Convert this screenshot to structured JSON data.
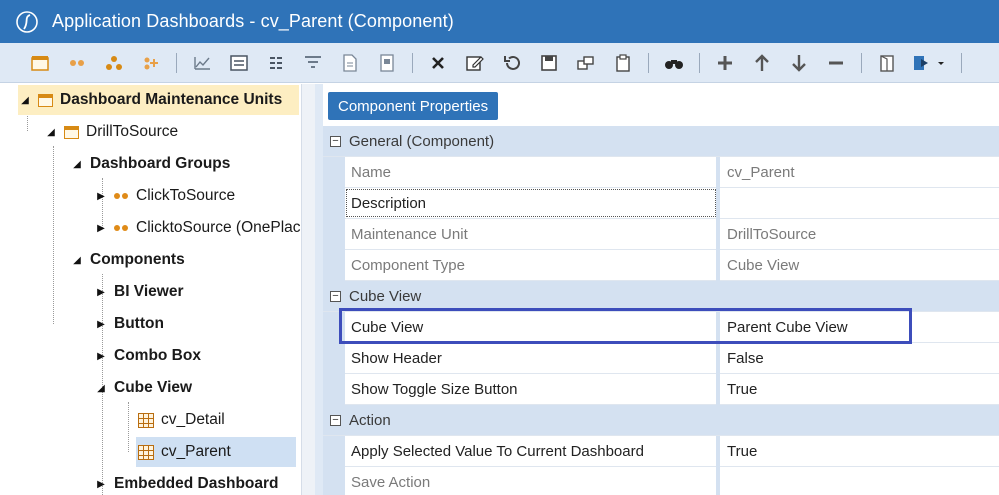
{
  "window": {
    "title": "Application Dashboards - cv_Parent (Component)"
  },
  "toolbar": {
    "buttons": [
      {
        "icon": "dashboard-icon"
      },
      {
        "icon": "dots-icon"
      },
      {
        "icon": "group-icon"
      },
      {
        "icon": "add-group-icon"
      },
      {
        "icon": "chart-icon"
      },
      {
        "icon": "form-icon"
      },
      {
        "icon": "list-icon"
      },
      {
        "icon": "filter-icon"
      },
      {
        "icon": "document-icon"
      },
      {
        "icon": "page-icon"
      },
      {
        "icon": "delete-icon"
      },
      {
        "icon": "edit-icon"
      },
      {
        "icon": "undo-icon"
      },
      {
        "icon": "save-icon"
      },
      {
        "icon": "copy-icon"
      },
      {
        "icon": "clipboard-icon"
      },
      {
        "icon": "binoculars-icon"
      },
      {
        "icon": "plus-icon"
      },
      {
        "icon": "arrow-up-icon"
      },
      {
        "icon": "arrow-down-icon"
      },
      {
        "icon": "minus-icon"
      },
      {
        "icon": "open-icon"
      },
      {
        "icon": "run-icon"
      }
    ]
  },
  "tree": {
    "root": "Dashboard Maintenance Units",
    "unit": "DrillToSource",
    "groups_label": "Dashboard Groups",
    "groups": [
      "ClickToSource",
      "ClicktoSource (OnePlace)"
    ],
    "components_label": "Components",
    "component_types": [
      "BI Viewer",
      "Button",
      "Combo Box",
      "Cube View",
      "Embedded Dashboard"
    ],
    "cube_views": [
      "cv_Detail",
      "cv_Parent"
    ]
  },
  "properties": {
    "header": "Component Properties",
    "categories": {
      "general": "General (Component)",
      "cube_view": "Cube View",
      "action": "Action"
    },
    "rows": {
      "name": {
        "label": "Name",
        "value": "cv_Parent"
      },
      "description": {
        "label": "Description",
        "value": ""
      },
      "maintenance_unit": {
        "label": "Maintenance Unit",
        "value": "DrillToSource"
      },
      "component_type": {
        "label": "Component Type",
        "value": "Cube View"
      },
      "cube_view": {
        "label": "Cube View",
        "value": "Parent Cube View"
      },
      "show_header": {
        "label": "Show Header",
        "value": "False"
      },
      "show_toggle": {
        "label": "Show Toggle Size Button",
        "value": "True"
      },
      "apply_selected": {
        "label": "Apply Selected Value To Current Dashboard",
        "value": "True"
      },
      "save_action": {
        "label": "Save Action",
        "value": ""
      }
    }
  },
  "colors": {
    "titlebar": "#2f73b8",
    "toolbar": "#dfe9f5",
    "category": "#d4e1f1",
    "highlight": "#3d4dbb"
  }
}
